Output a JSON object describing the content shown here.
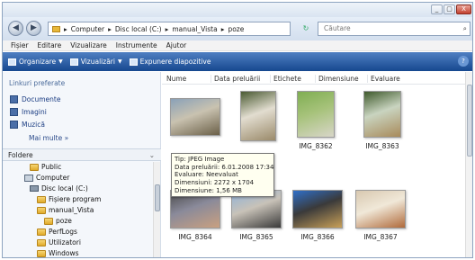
{
  "window": {
    "controls": [
      "_",
      "▢",
      "X"
    ]
  },
  "address": {
    "back": "◀",
    "forward": "▶",
    "path": [
      "Computer",
      "Disc local (C:)",
      "manual_Vista",
      "poze"
    ],
    "separator": "▸",
    "refresh": "↻",
    "search_placeholder": "Căutare",
    "search_icon": "⌕"
  },
  "menu": [
    "Fișier",
    "Editare",
    "Vizualizare",
    "Instrumente",
    "Ajutor"
  ],
  "toolbar": {
    "organize": "Organizare",
    "views": "Vizualizări",
    "slideshow": "Expunere diapozitive",
    "help": "?"
  },
  "sidebar": {
    "favorites_heading": "Linkuri preferate",
    "favorites": [
      "Documente",
      "Imagini",
      "Muzică"
    ],
    "more": "Mai multe »",
    "folders_heading": "Foldere",
    "folders_chevron": "⌄",
    "tree": [
      {
        "label": "Public",
        "icon": "folder"
      },
      {
        "label": "Computer",
        "icon": "computer"
      },
      {
        "label": "Disc local (C:)",
        "icon": "drive"
      },
      {
        "label": "Fișiere program",
        "icon": "folder"
      },
      {
        "label": "manual_Vista",
        "icon": "folder"
      },
      {
        "label": "poze",
        "icon": "folder"
      },
      {
        "label": "PerfLogs",
        "icon": "folder"
      },
      {
        "label": "Utilizatori",
        "icon": "folder"
      },
      {
        "label": "Windows",
        "icon": "folder"
      }
    ]
  },
  "columns": [
    "Nume",
    "Data preluării",
    "Etichete",
    "Dimensiune",
    "Evaluare"
  ],
  "files": [
    {
      "name": "",
      "colors": [
        "#8aa1b8",
        "#6b6048",
        "#c9c2b0"
      ]
    },
    {
      "name": "",
      "colors": [
        "#4a5a32",
        "#9a8a6a",
        "#e2ddd0"
      ]
    },
    {
      "name": "IMG_8362",
      "colors": [
        "#7fae52",
        "#d8d6c8",
        "#a6c27a"
      ]
    },
    {
      "name": "IMG_8363",
      "colors": [
        "#3f5a2c",
        "#a88a5a",
        "#c9d4c0"
      ]
    },
    {
      "name": "IMG_8364",
      "colors": [
        "#4a4a4a",
        "#c9a080",
        "#8a8a9a"
      ]
    },
    {
      "name": "IMG_8365",
      "colors": [
        "#8fb2d8",
        "#3a3a3a",
        "#c8c2b8"
      ]
    },
    {
      "name": "IMG_8366",
      "colors": [
        "#2f6fc8",
        "#c8a058",
        "#3a3a3a"
      ]
    },
    {
      "name": "IMG_8367",
      "colors": [
        "#d8c8b0",
        "#b06a3a",
        "#f0e8d8"
      ]
    }
  ],
  "tooltip": [
    "Tip: JPEG Image",
    "Data preluării: 6.01.2008 17:34",
    "Evaluare: Neevaluat",
    "Dimensiuni: 2272 x 1704",
    "Dimensiune: 1,56 MB"
  ]
}
